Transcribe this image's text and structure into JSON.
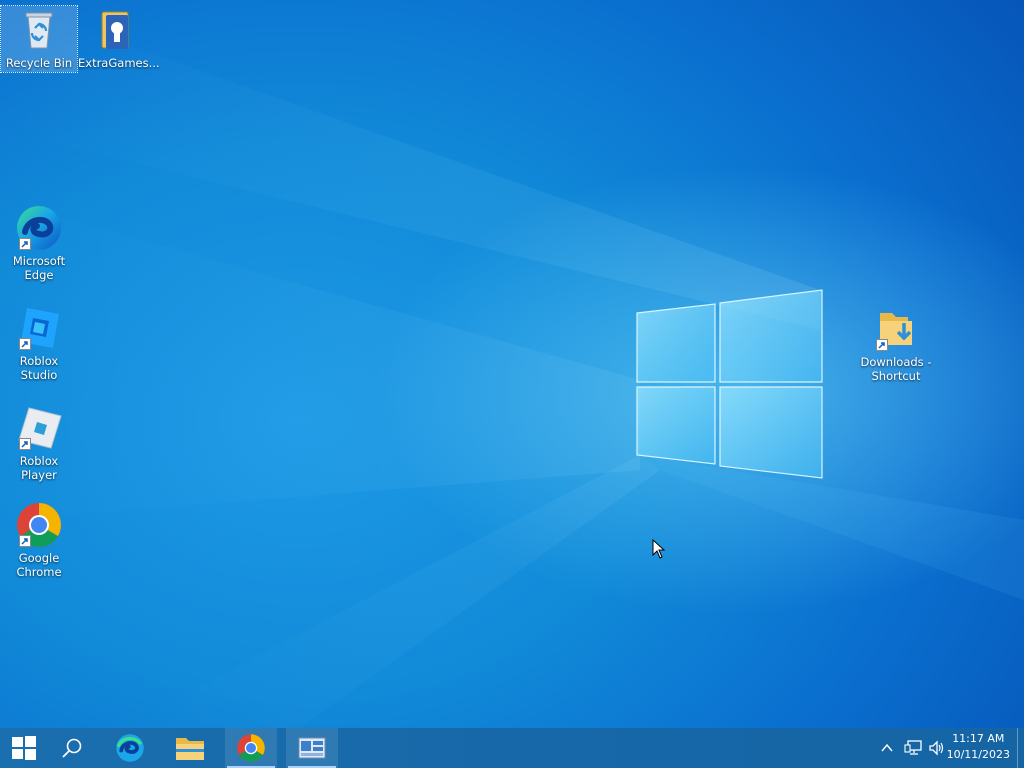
{
  "desktop": {
    "icons": [
      {
        "label": "Recycle Bin"
      },
      {
        "label": "ExtraGames..."
      },
      {
        "label": "Microsoft Edge"
      },
      {
        "label": "Roblox Studio"
      },
      {
        "label": "Roblox Player"
      },
      {
        "label": "Google Chrome"
      },
      {
        "label": "Downloads - Shortcut"
      }
    ]
  },
  "taskbar": {
    "clock": {
      "time": "11:17 AM",
      "date": "10/11/2023"
    },
    "apps": [
      "start-icon",
      "search-icon",
      "edge-icon",
      "file-explorer-icon",
      "chrome-icon",
      "control-panel-icon"
    ],
    "tray": [
      "show-hidden-icons-chevron",
      "network-icon",
      "volume-icon"
    ]
  },
  "colors": {
    "desktop_bg": "#0a64c8",
    "taskbar_bg": "#1669a6",
    "accent": "#a8d3ff"
  }
}
